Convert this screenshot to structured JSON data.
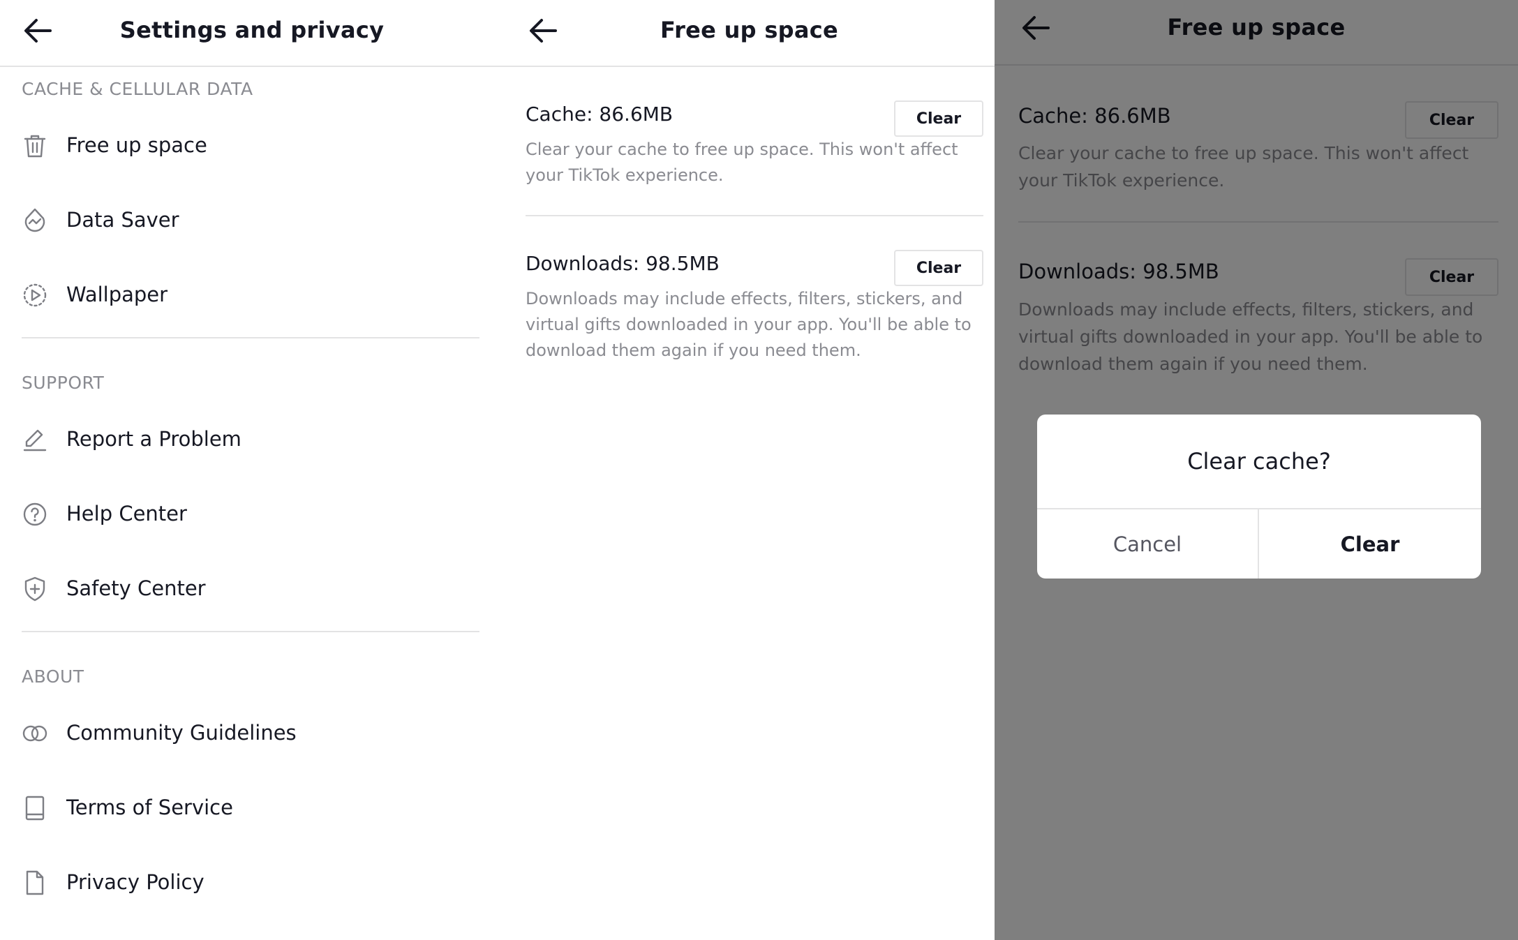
{
  "settings": {
    "title": "Settings and privacy",
    "sections": [
      {
        "label": "CACHE & CELLULAR DATA",
        "items": [
          {
            "label": "Free up space",
            "icon": "trash-icon"
          },
          {
            "label": "Data Saver",
            "icon": "data-saver-icon"
          },
          {
            "label": "Wallpaper",
            "icon": "wallpaper-icon"
          }
        ]
      },
      {
        "label": "SUPPORT",
        "items": [
          {
            "label": "Report a Problem",
            "icon": "pencil-icon"
          },
          {
            "label": "Help Center",
            "icon": "help-icon"
          },
          {
            "label": "Safety Center",
            "icon": "shield-icon"
          }
        ]
      },
      {
        "label": "ABOUT",
        "items": [
          {
            "label": "Community Guidelines",
            "icon": "guidelines-icon"
          },
          {
            "label": "Terms of Service",
            "icon": "book-icon"
          },
          {
            "label": "Privacy Policy",
            "icon": "document-icon"
          }
        ]
      }
    ]
  },
  "free_up_space": {
    "title": "Free up space",
    "cache": {
      "label": "Cache: 86.6MB",
      "description": "Clear your cache to free up space. This won't affect your TikTok experience.",
      "button": "Clear"
    },
    "downloads": {
      "label": "Downloads: 98.5MB",
      "description": "Downloads may include effects, filters, stickers, and virtual gifts downloaded in your app. You'll be able to download them again if you need them.",
      "button": "Clear"
    }
  },
  "dialog": {
    "title": "Clear cache?",
    "cancel": "Cancel",
    "confirm": "Clear"
  },
  "colors": {
    "text_primary": "#161823",
    "text_secondary": "#8a8b91",
    "divider": "#e3e3e4",
    "scrim": "rgba(0,0,0,0.5)"
  }
}
